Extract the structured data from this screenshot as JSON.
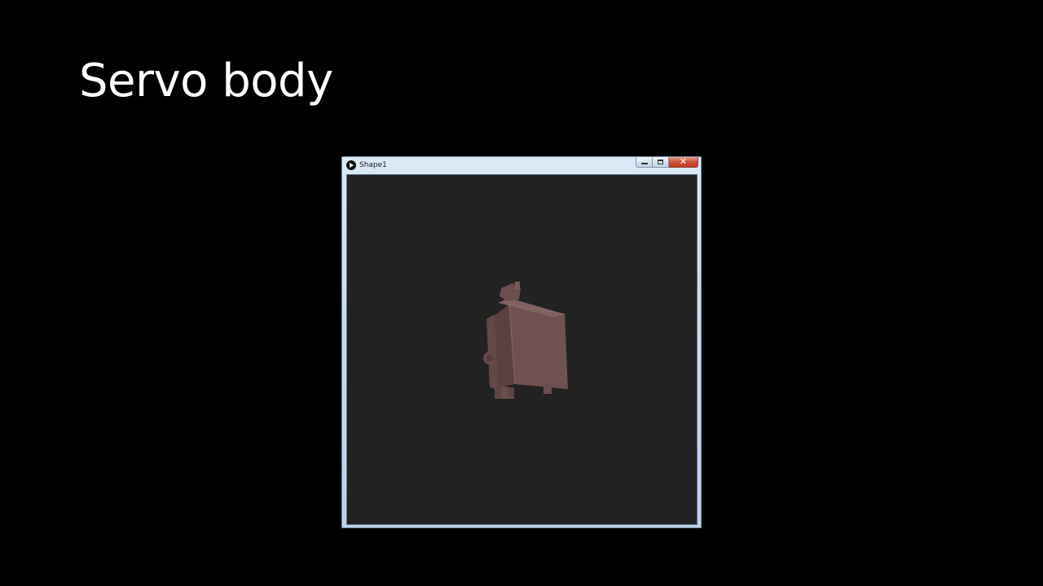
{
  "slide": {
    "title": "Servo body"
  },
  "window": {
    "title": "Shape1",
    "icon": "processing-play-icon",
    "viewport_background": "#222222",
    "model_color": "#7a5a58"
  }
}
